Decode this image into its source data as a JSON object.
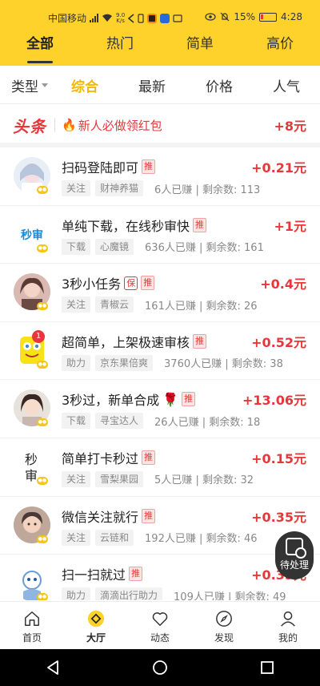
{
  "status_bar": {
    "carrier": "中国移动",
    "net_speed_value": "9.0",
    "net_speed_unit": "K/s",
    "battery": "15%",
    "time": "4:28"
  },
  "top_tabs": [
    {
      "label": "全部",
      "active": true
    },
    {
      "label": "热门",
      "active": false
    },
    {
      "label": "简单",
      "active": false
    },
    {
      "label": "高价",
      "active": false
    }
  ],
  "filters": {
    "type_label": "类型",
    "options": [
      {
        "label": "综合",
        "active": true
      },
      {
        "label": "最新",
        "active": false
      },
      {
        "label": "价格",
        "active": false
      },
      {
        "label": "人气",
        "active": false
      }
    ]
  },
  "headline": {
    "brand": "头条",
    "text": "新人必做领红包",
    "amount": "+8元"
  },
  "tasks": [
    {
      "title": "扫码登陆即可",
      "tags": [
        "推"
      ],
      "price": "+0.21元",
      "category": "关注",
      "merchant": "财神养猫",
      "earned": "6人已赚",
      "remaining": "剩余数: 113",
      "avatar": "anime-girl-avatar"
    },
    {
      "title": "单纯下载，在线秒审快",
      "tags": [
        "推"
      ],
      "price": "+1元",
      "category": "下载",
      "merchant": "心魔镜",
      "earned": "636人已赚",
      "remaining": "剩余数: 161",
      "avatar": "miao-shen-logo",
      "avatar_text": "秒审"
    },
    {
      "title": "3秒小任务",
      "tags": [
        "保",
        "推"
      ],
      "price": "+0.4元",
      "category": "关注",
      "merchant": "青椒云",
      "earned": "161人已赚",
      "remaining": "剩余数: 26",
      "avatar": "girl-photo-avatar"
    },
    {
      "title": "超简单，上架极速审核",
      "tags": [
        "推"
      ],
      "price": "+0.52元",
      "category": "助力",
      "merchant": "京东果倍爽",
      "earned": "3760人已赚",
      "remaining": "剩余数: 38",
      "avatar": "spongebob-avatar",
      "badge_count": "1"
    },
    {
      "title": "3秒过，新单合成",
      "tags": [
        "推"
      ],
      "price": "+13.06元",
      "category": "下载",
      "merchant": "寻宝达人",
      "earned": "26人已赚",
      "remaining": "剩余数: 18",
      "avatar": "girl-selfie-avatar",
      "emoji": "🌹"
    },
    {
      "title": "简单打卡秒过",
      "tags": [
        "推"
      ],
      "price": "+0.15元",
      "category": "关注",
      "merchant": "雪梨果园",
      "earned": "5人已赚",
      "remaining": "剩余数: 32",
      "avatar": "miao-shen-text-avatar",
      "avatar_text": "秒审"
    },
    {
      "title": "微信关注就行",
      "tags": [
        "推"
      ],
      "price": "+0.35元",
      "category": "关注",
      "merchant": "云链和",
      "earned": "192人已赚",
      "remaining": "剩余数: 46",
      "avatar": "child-photo-avatar"
    },
    {
      "title": "扫一扫就过",
      "tags": [
        "推"
      ],
      "price": "+0.35元",
      "category": "助力",
      "merchant": "滴滴出行助力",
      "earned": "109人已赚",
      "remaining": "剩余数: 49",
      "avatar": "cartoon-avatar"
    }
  ],
  "floating_button": {
    "label": "待处理",
    "icon": "pending-task-icon"
  },
  "bottom_nav": [
    {
      "label": "首页",
      "icon": "home-icon",
      "active": false
    },
    {
      "label": "大厅",
      "icon": "hall-coin-icon",
      "active": true
    },
    {
      "label": "动态",
      "icon": "heart-icon",
      "active": false
    },
    {
      "label": "发现",
      "icon": "compass-icon",
      "active": false
    },
    {
      "label": "我的",
      "icon": "user-icon",
      "active": false
    }
  ],
  "colors": {
    "brand_yellow": "#FFD12B",
    "accent_red": "#E8363B",
    "active_filter": "#F5B800"
  }
}
